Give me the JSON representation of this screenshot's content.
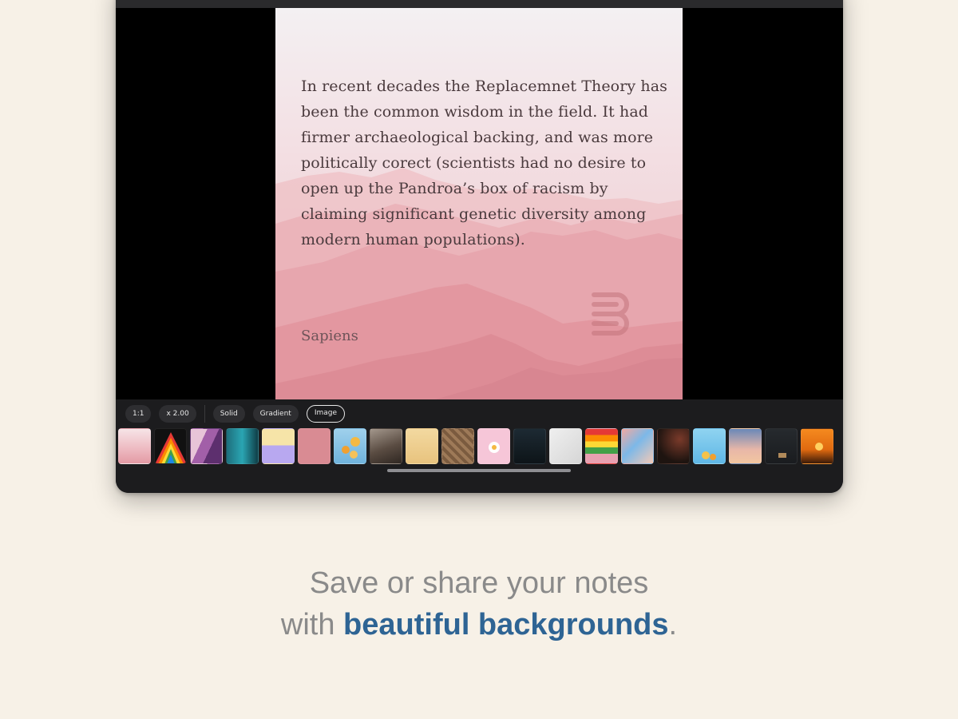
{
  "card": {
    "quote": "In recent decades the Replacemnet Theory has been the common wisdom in the field. It had firmer archaeological backing, and was more politically corect (scientists had no desire to open up the Pandroa’s box of racism by claiming significant genetic diversity among modern human populations).",
    "source": "Sapiens"
  },
  "toolbar": {
    "ratio_label": "1:1",
    "scale_label": "x 2.00",
    "solid_label": "Solid",
    "gradient_label": "Gradient",
    "image_label": "Image",
    "selected_tab": "Image"
  },
  "caption": {
    "line1": "Save or share your notes",
    "line2_prefix": "with ",
    "line2_highlight": "beautiful backgrounds",
    "line2_suffix": "."
  },
  "colors": {
    "background": "#f7f1e7",
    "highlight": "#2e6494",
    "caption_text": "#8a8a8a"
  }
}
